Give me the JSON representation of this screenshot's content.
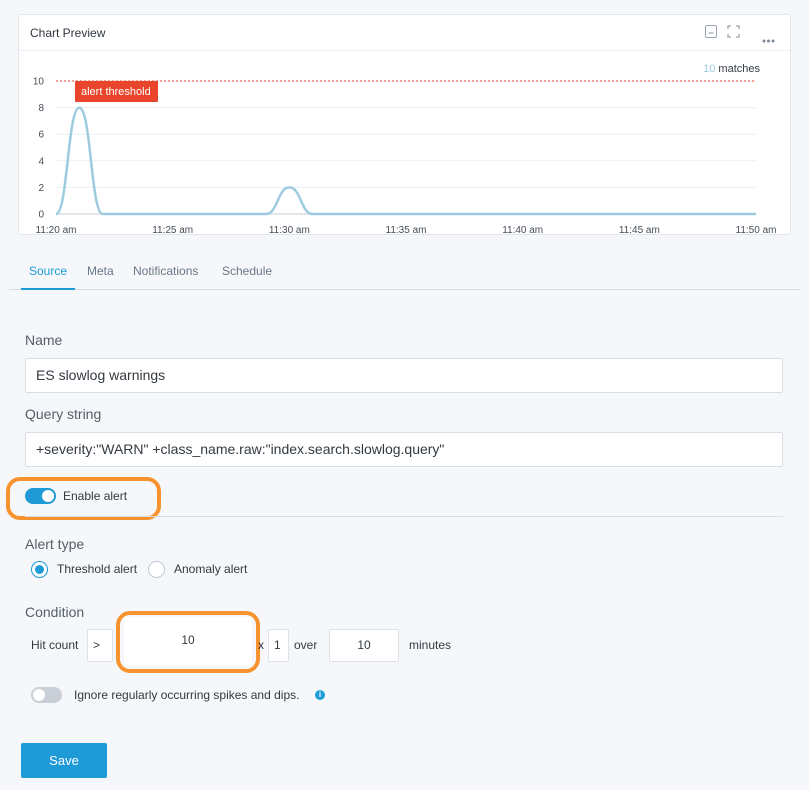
{
  "chart_card": {
    "title": "Chart Preview",
    "icons": [
      "minimize-icon",
      "expand-icon",
      "more-icon"
    ],
    "matches_count": "10",
    "matches_label": "matches",
    "threshold_label": "alert threshold"
  },
  "chart_data": {
    "type": "line",
    "x": [
      "11:20 am",
      "11:21 am",
      "11:22 am",
      "11:23 am",
      "11:24 am",
      "11:25 am",
      "11:26 am",
      "11:27 am",
      "11:28 am",
      "11:29 am",
      "11:30 am",
      "11:31 am",
      "11:32 am",
      "11:33 am",
      "11:34 am",
      "11:35 am",
      "11:36 am",
      "11:37 am",
      "11:38 am",
      "11:39 am",
      "11:40 am",
      "11:41 am",
      "11:42 am",
      "11:43 am",
      "11:44 am",
      "11:45 am",
      "11:46 am",
      "11:47 am",
      "11:48 am",
      "11:49 am",
      "11:50 am"
    ],
    "values": [
      0,
      8,
      0,
      0,
      0,
      0,
      0,
      0,
      0,
      0,
      2,
      0,
      0,
      0,
      0,
      0,
      0,
      0,
      0,
      0,
      0,
      0,
      0,
      0,
      0,
      0,
      0,
      0,
      0,
      0,
      0
    ],
    "x_ticks": [
      "11:20 am",
      "11:25 am",
      "11:30 am",
      "11:35 am",
      "11:40 am",
      "11:45 am",
      "11:50 am"
    ],
    "y_ticks": [
      "0",
      "2",
      "4",
      "6",
      "8",
      "10"
    ],
    "ylim": [
      0,
      10
    ],
    "threshold": 10,
    "grid": true,
    "line_color": "#9ecbe0",
    "threshold_color": "#e8452c"
  },
  "tabs": [
    {
      "label": "Source",
      "active": true
    },
    {
      "label": "Meta",
      "active": false
    },
    {
      "label": "Notifications",
      "active": false
    },
    {
      "label": "Schedule",
      "active": false
    }
  ],
  "form": {
    "name_label": "Name",
    "name_value": "ES slowlog warnings",
    "query_label": "Query string",
    "query_value": "+severity:\"WARN\" +class_name.raw:\"index.search.slowlog.query\"",
    "enable_alert_label": "Enable alert",
    "enable_alert_on": true,
    "alert_type_label": "Alert type",
    "alert_type_options": [
      "Threshold alert",
      "Anomaly alert"
    ],
    "alert_type_selected": "Threshold alert",
    "condition_label": "Condition",
    "condition": {
      "metric_label": "Hit count",
      "operator": ">",
      "threshold_value": "10",
      "times_symbol": "x",
      "multiplier": "1",
      "over_label": "over",
      "window_value": "10",
      "unit_label": "minutes"
    },
    "ignore_spikes_label": "Ignore regularly occurring spikes and dips.",
    "ignore_spikes_on": false,
    "save_label": "Save"
  },
  "colors": {
    "accent": "#1e9ad6",
    "highlight": "#f7932f"
  }
}
